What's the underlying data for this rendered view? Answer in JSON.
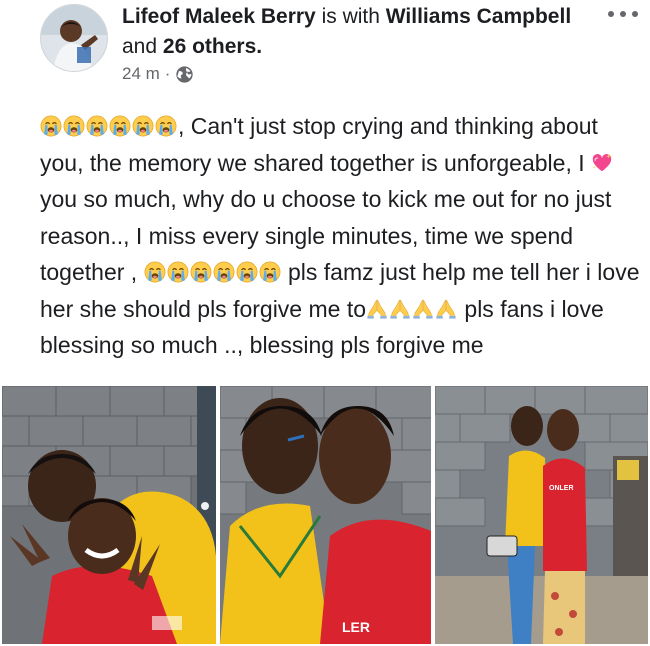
{
  "post": {
    "author": "Lifeof Maleek Berry",
    "with_word": "is with",
    "tagged_name": "Williams Campbell",
    "and_word": "and",
    "others": "26 others.",
    "time": "24 m",
    "separator": "·",
    "privacy_icon": "globe-icon",
    "more_icon": "more-options-icon"
  },
  "body": {
    "emoji_crying": "crying-face-emoji",
    "emoji_heart": "sparkling-heart-emoji",
    "emoji_pray": "praying-hands-emoji",
    "seg1": ", Can't just stop crying and thinking about you, the memory we shared together is unforgeable, I ",
    "seg2": " you so much, why do u choose to kick me out for no just reason.., I miss every single minutes, time we spend together , ",
    "seg3": " pls famz just help me tell her i love her she should pls forgive me to",
    "seg4": " pls fans i love blessing so much .., blessing pls forgive me"
  },
  "photos": {
    "photo1": "photo-couple-selfie",
    "photo2": "photo-couple-kiss",
    "photo3": "photo-couple-standing",
    "jersey_text": "LER",
    "shirt_text": "ONLER"
  },
  "colors": {
    "text": "#1c1e21",
    "meta": "#65676b",
    "yellow_shirt": "#f2c21b",
    "red_shirt": "#d9232e",
    "wall": "#6f7378"
  }
}
